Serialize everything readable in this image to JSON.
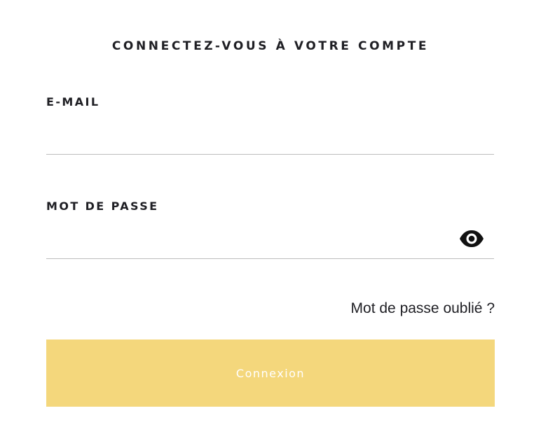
{
  "login": {
    "title": "CONNECTEZ-VOUS À VOTRE COMPTE",
    "email": {
      "label": "E-MAIL",
      "value": "",
      "placeholder": ""
    },
    "password": {
      "label": "MOT DE PASSE",
      "value": "",
      "placeholder": "",
      "toggle_icon": "eye-icon"
    },
    "forgot_password_link": "Mot de passe oublié ?",
    "submit_label": "Connexion"
  },
  "colors": {
    "button_background": "#f4d77c",
    "button_text": "#ffffff",
    "text": "#1f1f24",
    "divider": "#bdbdbd"
  }
}
